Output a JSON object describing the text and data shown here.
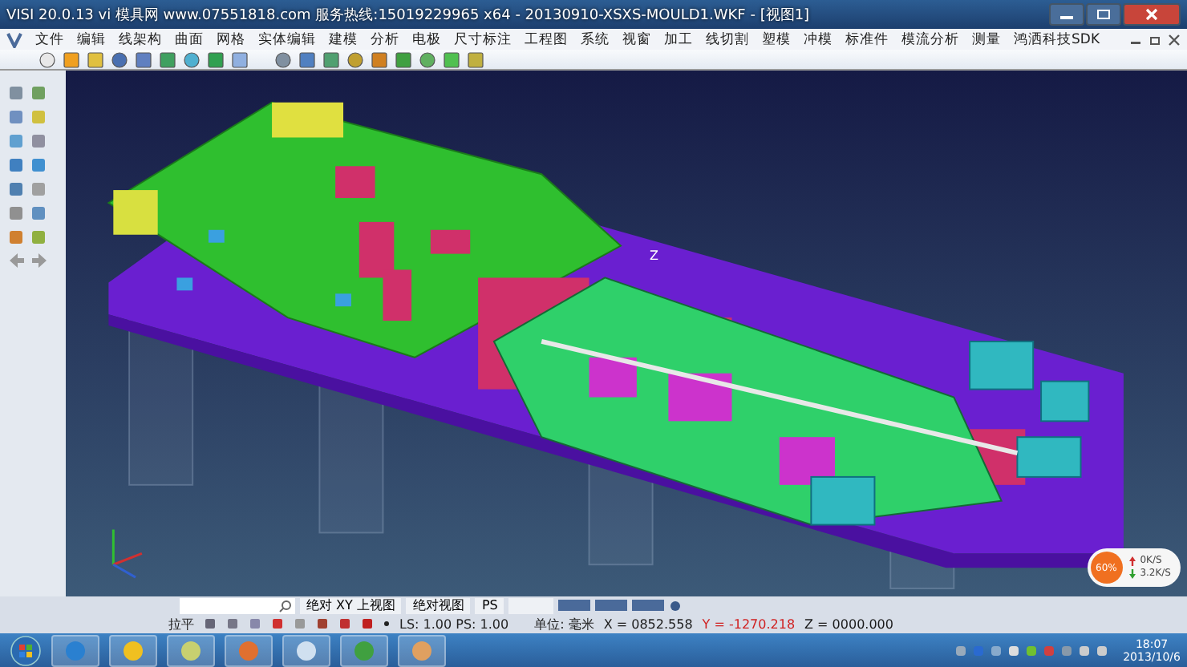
{
  "window": {
    "title": "VISI 20.0.13 vi 模具网 www.07551818.com 服务热线:15019229965 x64 - 20130910-XSXS-MOULD1.WKF - [视图1]"
  },
  "menu": [
    "文件",
    "编辑",
    "线架构",
    "曲面",
    "网格",
    "实体编辑",
    "建模",
    "分析",
    "电极",
    "尺寸标注",
    "工程图",
    "系统",
    "视窗",
    "加工",
    "线切割",
    "塑模",
    "冲模",
    "标准件",
    "模流分析",
    "测量",
    "鸿洒科技SDK"
  ],
  "viewport": {
    "axis_label": "Z"
  },
  "view_bar": {
    "labels": [
      "绝对 XY 上视图",
      "绝对视图",
      "PS"
    ]
  },
  "status_bar": {
    "mode": "拉平",
    "scale": "LS: 1.00 PS: 1.00",
    "unit": "单位: 毫米",
    "coords": [
      {
        "kind": "x",
        "text": "X = 0852.558"
      },
      {
        "kind": "y",
        "text": "Y = -1270.218"
      },
      {
        "kind": "z",
        "text": "Z = 0000.000"
      }
    ]
  },
  "net_monitor": {
    "percent": "60%",
    "up": "0K/S",
    "down": "3.2K/S"
  },
  "clock": {
    "time": "18:07",
    "date": "2013/10/6"
  }
}
